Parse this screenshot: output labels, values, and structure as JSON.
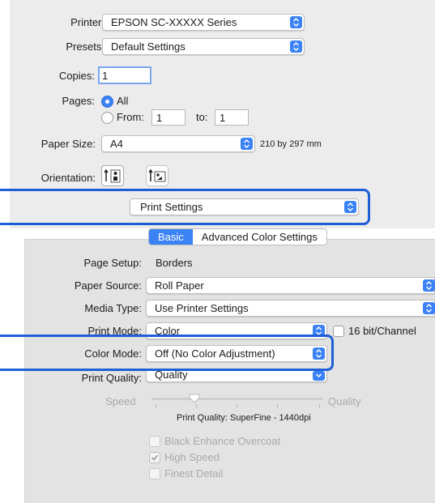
{
  "printer": {
    "label": "Printer:",
    "value": "EPSON SC-XXXXX Series"
  },
  "presets": {
    "label": "Presets:",
    "value": "Default Settings"
  },
  "copies": {
    "label": "Copies:",
    "value": "1"
  },
  "pages": {
    "label": "Pages:",
    "all_label": "All",
    "from_label": "From:",
    "from_value": "1",
    "to_label": "to:",
    "to_value": "1",
    "selected": "All"
  },
  "paper_size": {
    "label": "Paper Size:",
    "value": "A4",
    "dimensions": "210 by 297 mm"
  },
  "orientation": {
    "label": "Orientation:",
    "selected": "portrait"
  },
  "section_menu": {
    "value": "Print Settings"
  },
  "tabs": [
    {
      "label": "Basic",
      "active": true
    },
    {
      "label": "Advanced Color Settings",
      "active": false
    }
  ],
  "basic": {
    "page_setup": {
      "label": "Page Setup:",
      "value": "Borders"
    },
    "paper_source": {
      "label": "Paper Source:",
      "value": "Roll Paper"
    },
    "media_type": {
      "label": "Media Type:",
      "value": "Use Printer Settings"
    },
    "print_mode": {
      "label": "Print Mode:",
      "value": "Color",
      "checkbox_label": "16 bit/Channel"
    },
    "color_mode": {
      "label": "Color Mode:",
      "value": "Off (No Color Adjustment)"
    },
    "print_quality": {
      "label": "Print Quality:",
      "value": "Quality"
    },
    "slider": {
      "left_label": "Speed",
      "right_label": "Quality",
      "position": 0.25
    },
    "quality_info": "Print Quality: SuperFine - 1440dpi",
    "options": [
      {
        "label": "Black Enhance Overcoat",
        "checked": false,
        "enabled": false
      },
      {
        "label": "High Speed",
        "checked": true,
        "enabled": false
      },
      {
        "label": "Finest Detail",
        "checked": false,
        "enabled": false
      }
    ]
  },
  "colors": {
    "accent": "#3b82f6",
    "highlight": "#1f5fd6",
    "panel": "#e3e3e3",
    "dialog": "#ececec"
  }
}
